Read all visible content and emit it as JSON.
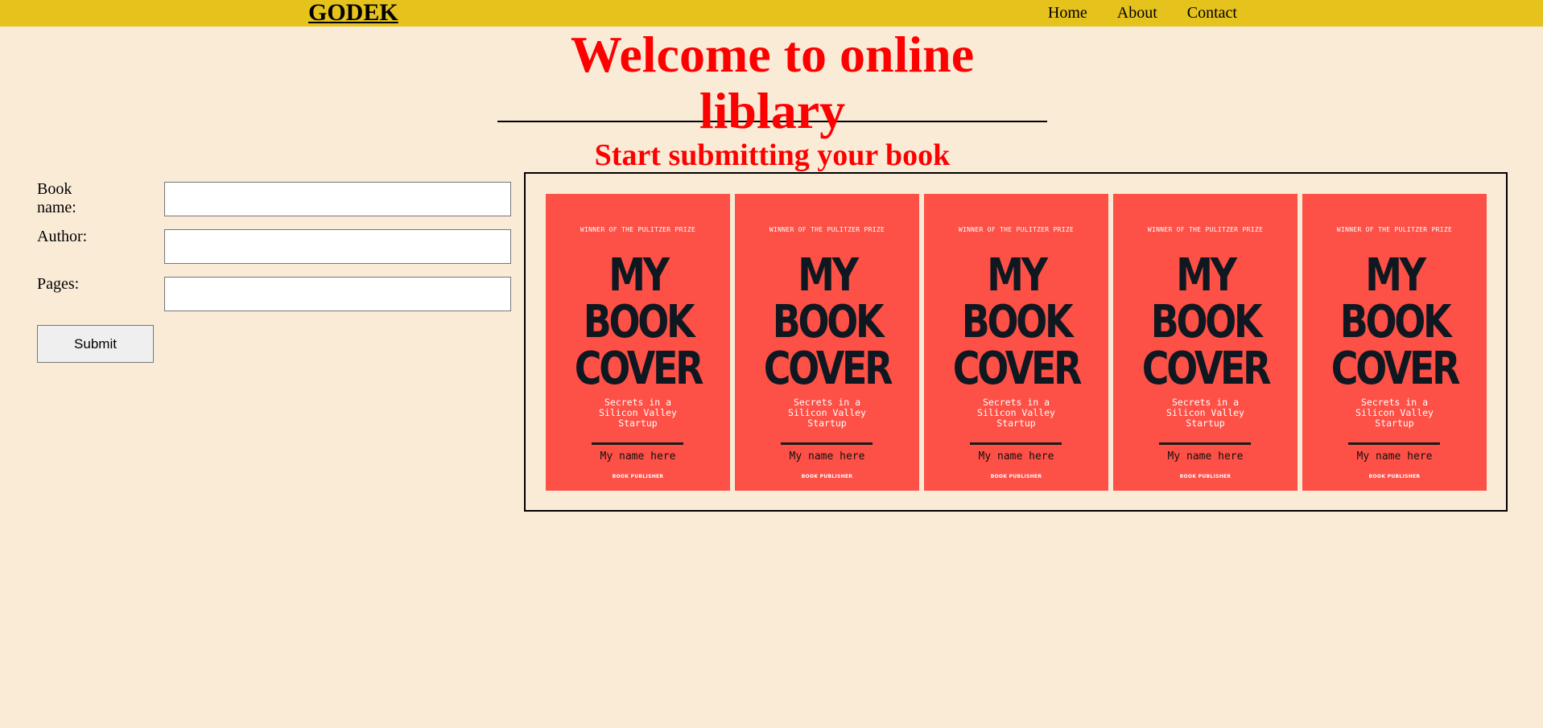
{
  "brand": "GODEK",
  "nav": [
    "Home",
    "About",
    "Contact"
  ],
  "header": {
    "title": "Welcome to online liblary",
    "subtitle": "Start submitting your book"
  },
  "form": {
    "fields": [
      {
        "label": "Book name:",
        "value": ""
      },
      {
        "label": "Author:",
        "value": ""
      },
      {
        "label": "Pages:",
        "value": ""
      }
    ],
    "submit_label": "Submit"
  },
  "covers": [
    {
      "prize": "WINNER OF THE PULITZER PRIZE",
      "title": "MY BOOK COVER",
      "subtitle": "Secrets in a\nSilicon Valley\nStartup",
      "author": "My name here",
      "publisher": "BOOK PUBLISHER"
    },
    {
      "prize": "WINNER OF THE PULITZER PRIZE",
      "title": "MY BOOK COVER",
      "subtitle": "Secrets in a\nSilicon Valley\nStartup",
      "author": "My name here",
      "publisher": "BOOK PUBLISHER"
    },
    {
      "prize": "WINNER OF THE PULITZER PRIZE",
      "title": "MY BOOK COVER",
      "subtitle": "Secrets in a\nSilicon Valley\nStartup",
      "author": "My name here",
      "publisher": "BOOK PUBLISHER"
    },
    {
      "prize": "WINNER OF THE PULITZER PRIZE",
      "title": "MY BOOK COVER",
      "subtitle": "Secrets in a\nSilicon Valley\nStartup",
      "author": "My name here",
      "publisher": "BOOK PUBLISHER"
    },
    {
      "prize": "WINNER OF THE PULITZER PRIZE",
      "title": "MY BOOK COVER",
      "subtitle": "Secrets in a\nSilicon Valley\nStartup",
      "author": "My name here",
      "publisher": "BOOK PUBLISHER"
    }
  ],
  "colors": {
    "page_background": "#faebd7",
    "topbar": "#e6c21c",
    "heading": "#ff0000",
    "cover": "#fd5046"
  }
}
